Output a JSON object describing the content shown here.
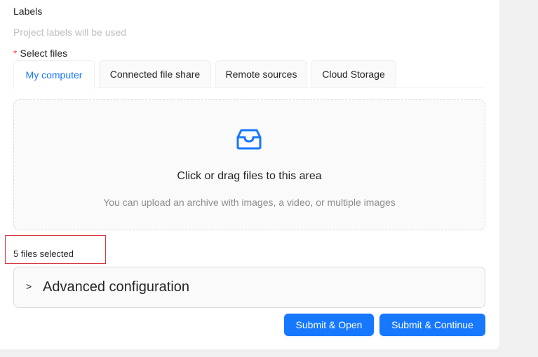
{
  "labels": {
    "title": "Labels",
    "hint": "Project labels will be used"
  },
  "select_files": {
    "required_mark": "*",
    "label": "Select files"
  },
  "tabs": [
    {
      "label": "My computer",
      "active": true
    },
    {
      "label": "Connected file share",
      "active": false
    },
    {
      "label": "Remote sources",
      "active": false
    },
    {
      "label": "Cloud Storage",
      "active": false
    }
  ],
  "dropzone": {
    "icon": "inbox-icon",
    "title": "Click or drag files to this area",
    "hint": "You can upload an archive with images, a video, or multiple images"
  },
  "status": {
    "files_selected": "5 files selected"
  },
  "advanced": {
    "chevron": ">",
    "title": "Advanced configuration"
  },
  "actions": {
    "submit_open": "Submit & Open",
    "submit_continue": "Submit & Continue"
  },
  "colors": {
    "accent": "#1677ff",
    "required": "#ff4d4f",
    "highlight_box": "#d9363e"
  }
}
